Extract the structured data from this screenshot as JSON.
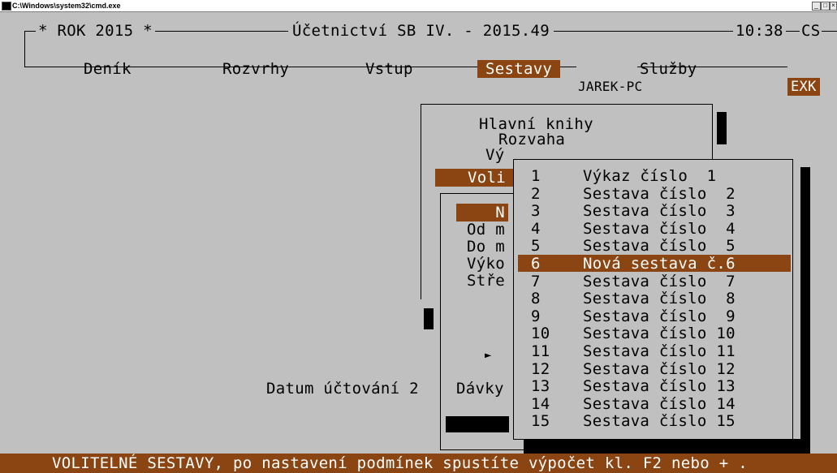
{
  "window": {
    "title": "C:\\Windows\\system32\\cmd.exe"
  },
  "header": {
    "year": "* ROK 2015 *",
    "app_title": "Účetnictví SB IV. - 2015.49",
    "time": "10:38",
    "lang": "CS",
    "host": "JAREK-PC",
    "mode": "EXK"
  },
  "menu": {
    "items": [
      "Deník",
      "Rozvrhy",
      "Vstup",
      "Sestavy",
      "Služby"
    ],
    "selected": "Sestavy"
  },
  "sestavy_menu": {
    "items": [
      "Hlavní knihy",
      "Rozvaha",
      "Vý",
      "Voli"
    ]
  },
  "options_panel": {
    "highlight": "N",
    "rows": [
      "Od m",
      "Do m",
      "Výko",
      "Stře"
    ],
    "arrow": "►",
    "date_label": "Datum účtování 2",
    "batch_label": "Dávky"
  },
  "report_list": {
    "selected_index": 5,
    "items": [
      {
        "num": "1",
        "name": "Výkaz číslo  1"
      },
      {
        "num": "2",
        "name": "Sestava číslo  2"
      },
      {
        "num": "3",
        "name": "Sestava číslo  3"
      },
      {
        "num": "4",
        "name": "Sestava číslo  4"
      },
      {
        "num": "5",
        "name": "Sestava číslo  5"
      },
      {
        "num": "6",
        "name": "Nová sestava č.6"
      },
      {
        "num": "7",
        "name": "Sestava číslo  7"
      },
      {
        "num": "8",
        "name": "Sestava číslo  8"
      },
      {
        "num": "9",
        "name": "Sestava číslo  9"
      },
      {
        "num": "10",
        "name": "Sestava číslo 10"
      },
      {
        "num": "11",
        "name": "Sestava číslo 11"
      },
      {
        "num": "12",
        "name": "Sestava číslo 12"
      },
      {
        "num": "13",
        "name": "Sestava číslo 13"
      },
      {
        "num": "14",
        "name": "Sestava číslo 14"
      },
      {
        "num": "15",
        "name": "Sestava číslo 15"
      }
    ]
  },
  "status_bar": {
    "text": "VOLITELNÉ SESTAVY, po nastavení podmínek spustíte výpočet kl. F2 nebo + ."
  },
  "colors": {
    "background": "#c0c0c0",
    "highlight": "#8b4513",
    "highlight_text": "#ffffff"
  }
}
